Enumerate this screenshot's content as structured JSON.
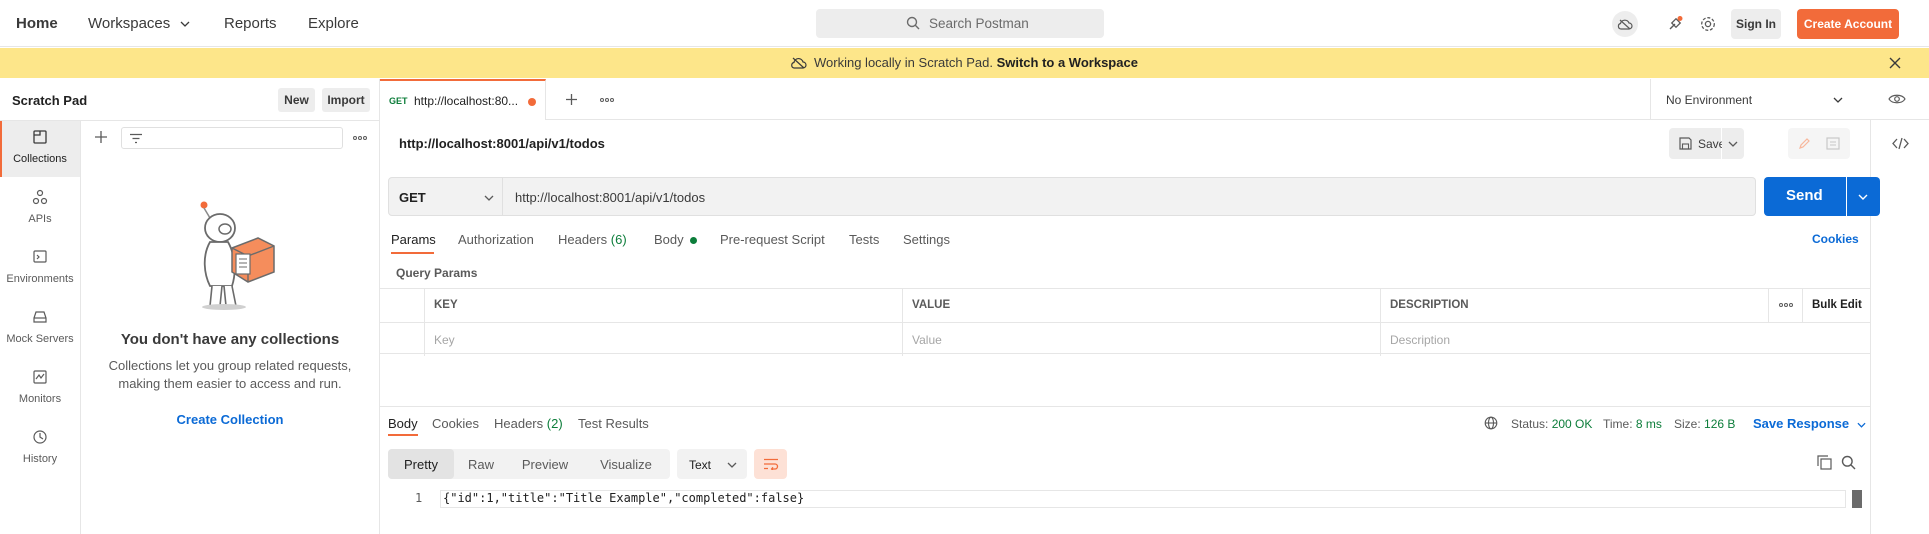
{
  "topnav": {
    "home": "Home",
    "workspaces": "Workspaces",
    "reports": "Reports",
    "explore": "Explore",
    "search_placeholder": "Search Postman",
    "sign_in": "Sign In",
    "create_account": "Create Account"
  },
  "banner": {
    "message": "Working locally in Scratch Pad.",
    "link": "Switch to a Workspace"
  },
  "left": {
    "title": "Scratch Pad",
    "new_label": "New",
    "import_label": "Import",
    "sidebar": [
      {
        "label": "Collections",
        "icon": "collections-icon"
      },
      {
        "label": "APIs",
        "icon": "apis-icon"
      },
      {
        "label": "Environments",
        "icon": "environments-icon"
      },
      {
        "label": "Mock Servers",
        "icon": "mock-servers-icon"
      },
      {
        "label": "Monitors",
        "icon": "monitors-icon"
      },
      {
        "label": "History",
        "icon": "history-icon"
      }
    ],
    "empty_title": "You don't have any collections",
    "empty_desc": "Collections let you group related requests, making them easier to access and run.",
    "create_collection": "Create Collection"
  },
  "tab": {
    "method": "GET",
    "title": "http://localhost:80..."
  },
  "environment": "No Environment",
  "request": {
    "title": "http://localhost:8001/api/v1/todos",
    "save_label": "Save",
    "method": "GET",
    "url": "http://localhost:8001/api/v1/todos",
    "send_label": "Send",
    "subtabs": {
      "params": "Params",
      "authorization": "Authorization",
      "headers": "Headers",
      "headers_count": "(6)",
      "body": "Body",
      "prerequest": "Pre-request Script",
      "tests": "Tests",
      "settings": "Settings"
    },
    "cookies_link": "Cookies",
    "query_params_title": "Query Params",
    "table": {
      "headers": [
        "KEY",
        "VALUE",
        "DESCRIPTION"
      ],
      "placeholders": [
        "Key",
        "Value",
        "Description"
      ],
      "bulk_edit": "Bulk Edit"
    }
  },
  "response": {
    "tabs": {
      "body": "Body",
      "cookies": "Cookies",
      "headers": "Headers",
      "headers_count": "(2)",
      "test_results": "Test Results"
    },
    "status_label": "Status:",
    "status_value": "200 OK",
    "time_label": "Time:",
    "time_value": "8 ms",
    "size_label": "Size:",
    "size_value": "126 B",
    "save_response": "Save Response",
    "views": [
      "Pretty",
      "Raw",
      "Preview",
      "Visualize"
    ],
    "format": "Text",
    "line_number": "1",
    "body_text": "{\"id\":1,\"title\":\"Title Example\",\"completed\":false}"
  },
  "colors": {
    "accent": "#f26b3a",
    "primary": "#0b6ad6",
    "banner": "#fde68a",
    "success": "#0c7d3a"
  }
}
